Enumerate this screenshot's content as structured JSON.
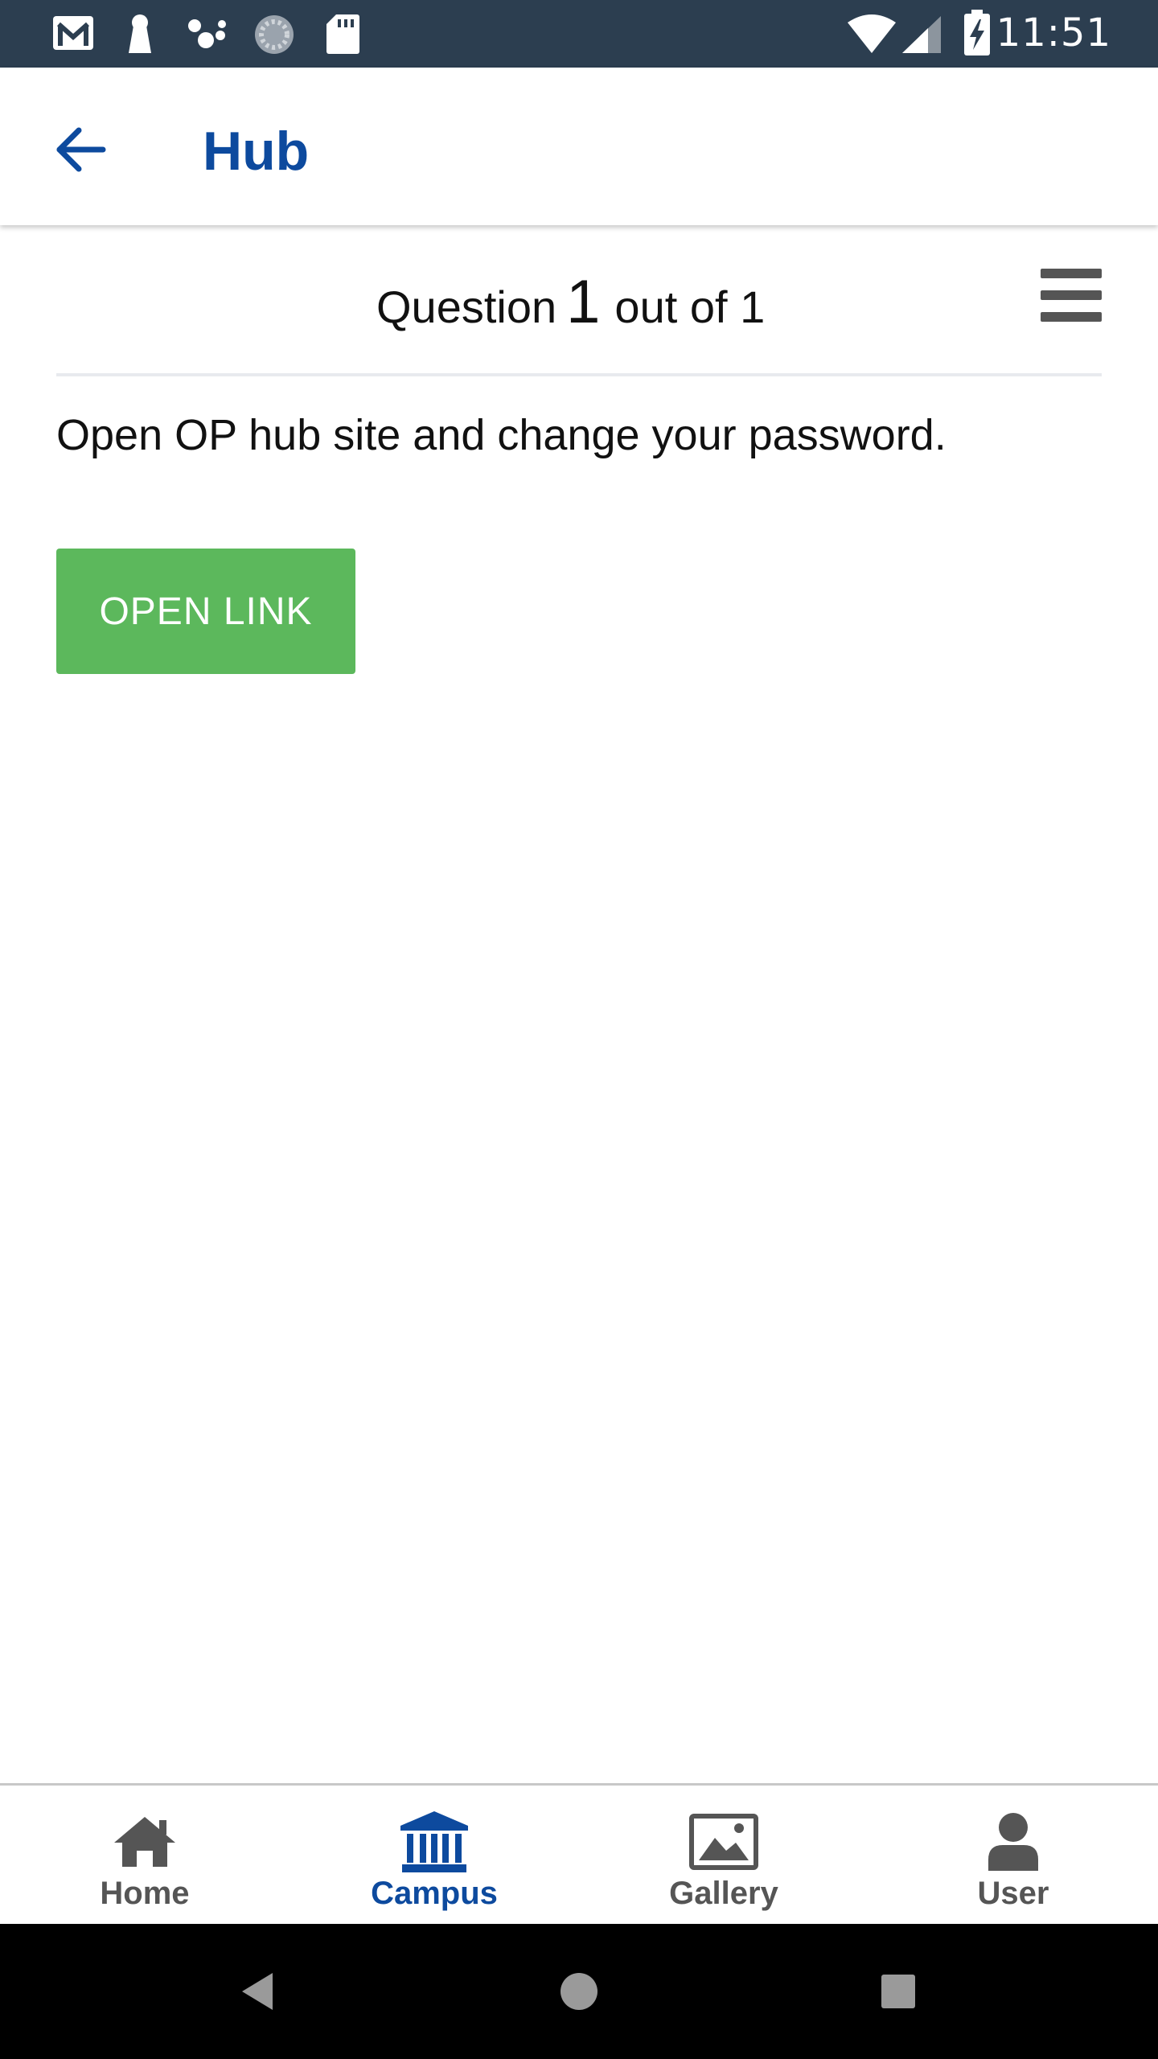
{
  "status_bar": {
    "time": "11:51",
    "icons": [
      "gmail-icon",
      "keyhole-icon",
      "assistant-dots-icon",
      "sync-icon",
      "sd-card-icon",
      "wifi-icon",
      "cell-signal-icon",
      "battery-charging-icon"
    ]
  },
  "app_bar": {
    "title": "Hub",
    "back_icon": "arrow-left-icon",
    "accent_color": "#0d4a9e"
  },
  "question": {
    "prefix": "Question",
    "current": "1",
    "suffix": "out of 1",
    "text": "Open OP hub site and change your password.",
    "menu_icon": "hamburger-menu-icon"
  },
  "actions": {
    "open_link_label": "OPEN LINK",
    "button_color": "#5cb85c"
  },
  "bottom_nav": {
    "items": [
      {
        "label": "Home",
        "icon": "home-icon",
        "active": false
      },
      {
        "label": "Campus",
        "icon": "bank-icon",
        "active": true
      },
      {
        "label": "Gallery",
        "icon": "image-icon",
        "active": false
      },
      {
        "label": "User",
        "icon": "user-icon",
        "active": false
      }
    ]
  },
  "system_nav": {
    "icons": [
      "back-triangle-icon",
      "home-circle-icon",
      "recents-square-icon"
    ]
  }
}
